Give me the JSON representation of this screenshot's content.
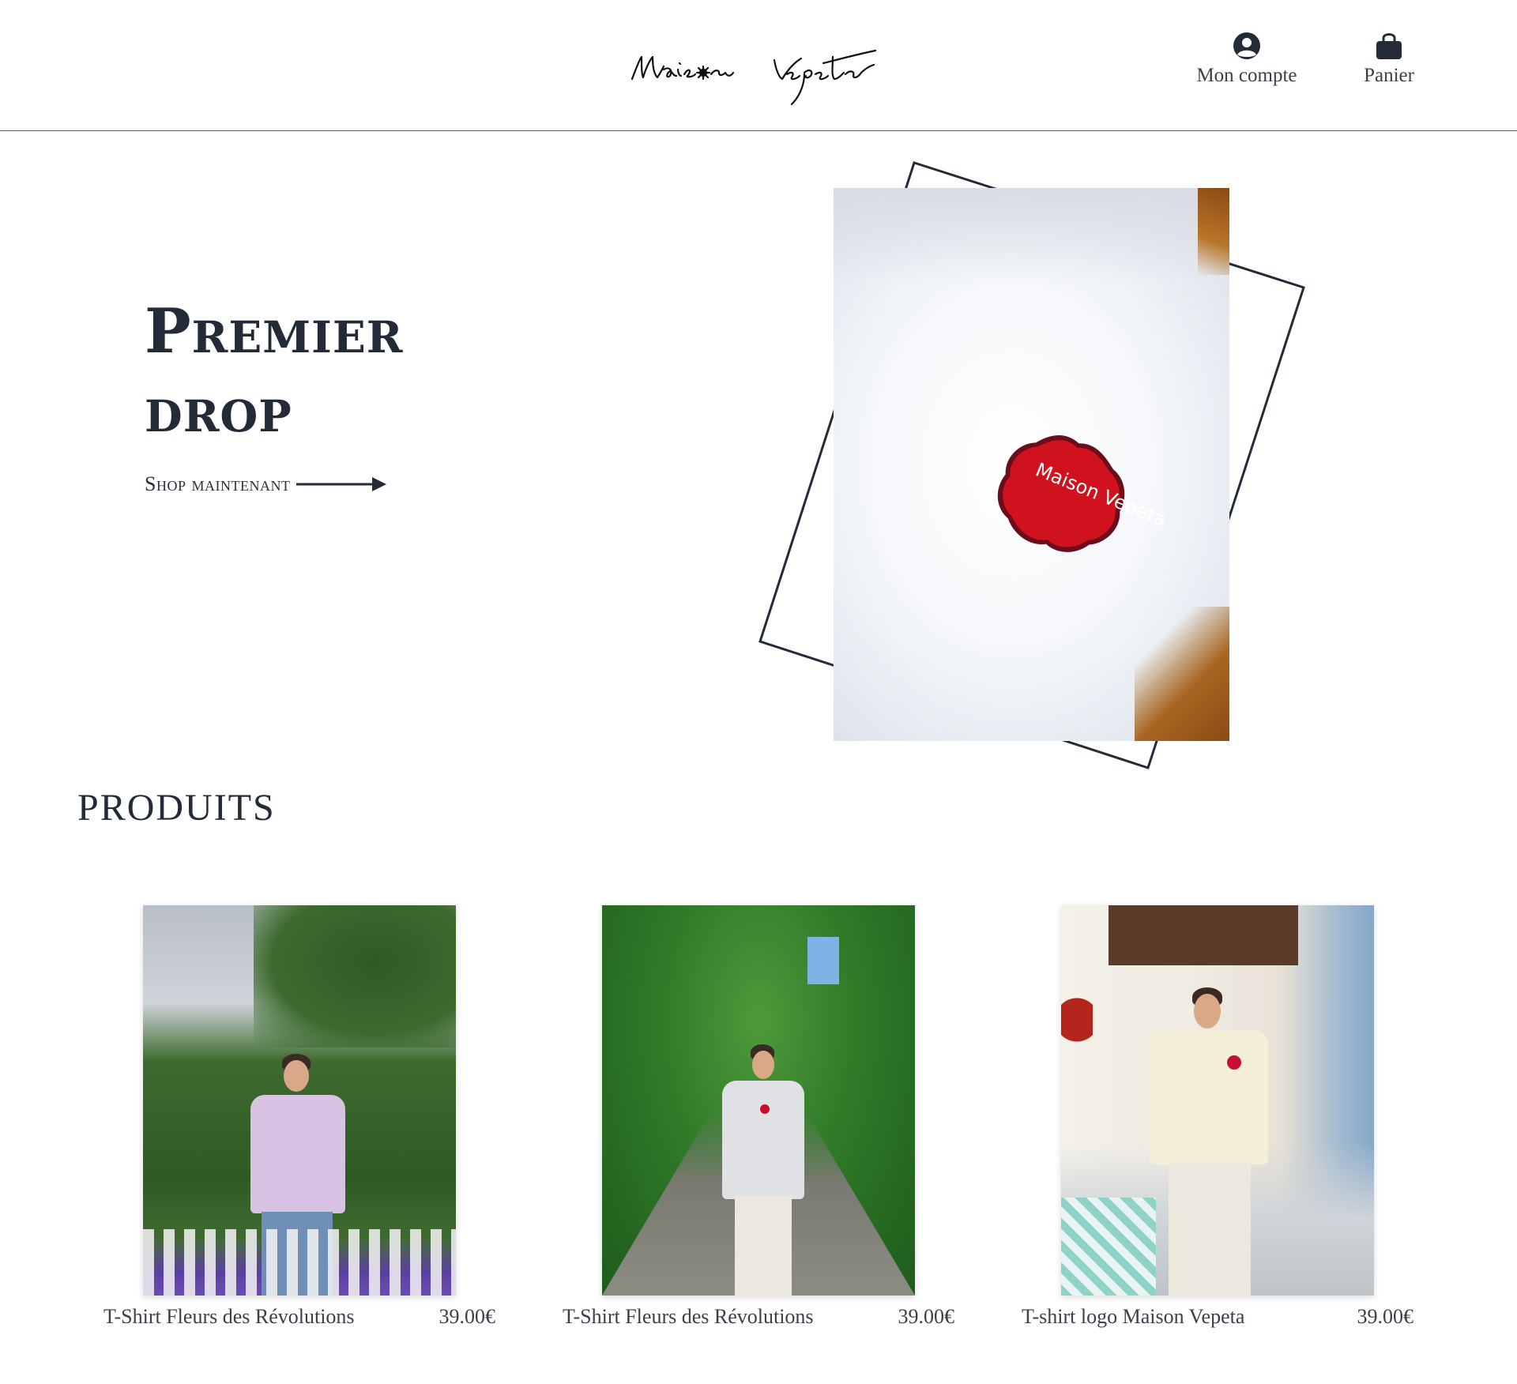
{
  "header": {
    "logo_text": "Maison Vepeta",
    "account_label": "Mon compte",
    "cart_label": "Panier",
    "account_icon": "user-circle-icon",
    "cart_icon": "shopping-bag-icon"
  },
  "hero": {
    "title_line1": "Premier",
    "title_line2": "drop",
    "cta_label": "Shop maintenant",
    "badge_text": "Maison Vepeta"
  },
  "products": {
    "title": "PRODUITS",
    "items": [
      {
        "name": "T-Shirt Fleurs des Révolutions",
        "price": "39.00€",
        "shirt_color": "#d9c3e3"
      },
      {
        "name": "T-Shirt Fleurs des Révolutions",
        "price": "39.00€",
        "shirt_color": "#dfe1e4"
      },
      {
        "name": "T-shirt logo Maison Vepeta",
        "price": "39.00€",
        "shirt_color": "#f3efd9"
      }
    ]
  },
  "colors": {
    "text": "#232a38",
    "accent_red": "#c8102e",
    "border": "#5b5f66"
  }
}
